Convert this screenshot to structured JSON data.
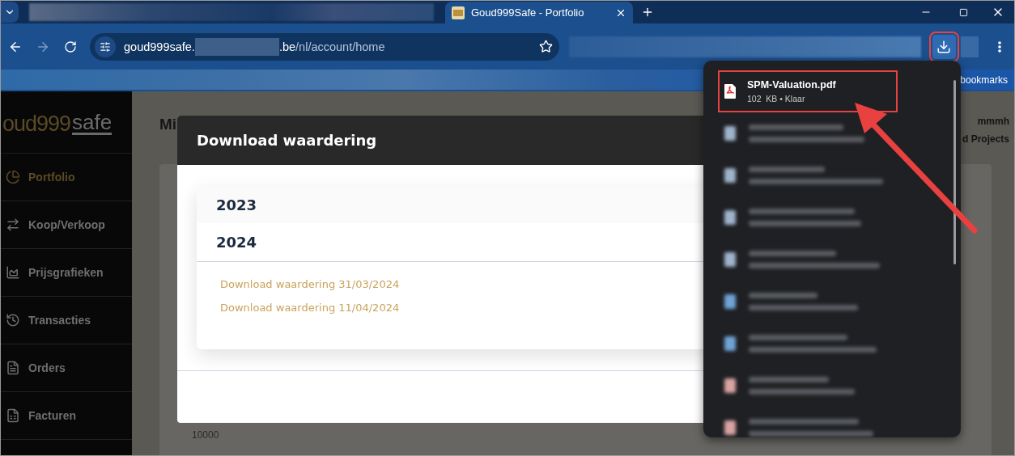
{
  "browser": {
    "tabs": [
      {
        "title": "Goud999Safe - Portfolio",
        "selected": true
      }
    ],
    "url": {
      "host": "goud999safe.",
      "host_end": ".be",
      "path": "/nl/account/home"
    },
    "bookmarks_bar": {
      "label": "bookmarks"
    },
    "download_button": {
      "highlighted": true
    }
  },
  "sidebar": {
    "logo": {
      "brand": "oud999",
      "suffix": "safe"
    },
    "items": [
      {
        "label": "Portfolio",
        "selected": true
      },
      {
        "label": "Koop/Verkoop",
        "selected": false
      },
      {
        "label": "Prijsgrafieken",
        "selected": false
      },
      {
        "label": "Transacties",
        "selected": false
      },
      {
        "label": "Orders",
        "selected": false
      },
      {
        "label": "Facturen",
        "selected": false
      }
    ]
  },
  "page": {
    "heading": "Mi",
    "user_lines": [
      "mmmh",
      "d Projects"
    ],
    "axis_label": "10000"
  },
  "modal": {
    "title": "Download waardering",
    "years": [
      {
        "label": "2023",
        "expanded": false
      },
      {
        "label": "2024",
        "expanded": true,
        "links": [
          "Download waardering 31/03/2024",
          "Download waardering 11/04/2024"
        ]
      }
    ]
  },
  "downloads": {
    "items": [
      {
        "kind": "file",
        "name": "SPM-Valuation.pdf",
        "status": "102  KB • Klaar",
        "highlighted": true
      },
      {
        "kind": "blurred",
        "color": "#9fb4cc"
      },
      {
        "kind": "blurred",
        "color": "#9fb4cc"
      },
      {
        "kind": "blurred",
        "color": "#9fb4cc"
      },
      {
        "kind": "blurred",
        "color": "#9fb4cc"
      },
      {
        "kind": "blurred",
        "color": "#6fa3d6"
      },
      {
        "kind": "blurred",
        "color": "#6fa3d6"
      },
      {
        "kind": "blurred",
        "color": "#d9a3a3"
      },
      {
        "kind": "blurred",
        "color": "#d9a3a3"
      }
    ]
  }
}
